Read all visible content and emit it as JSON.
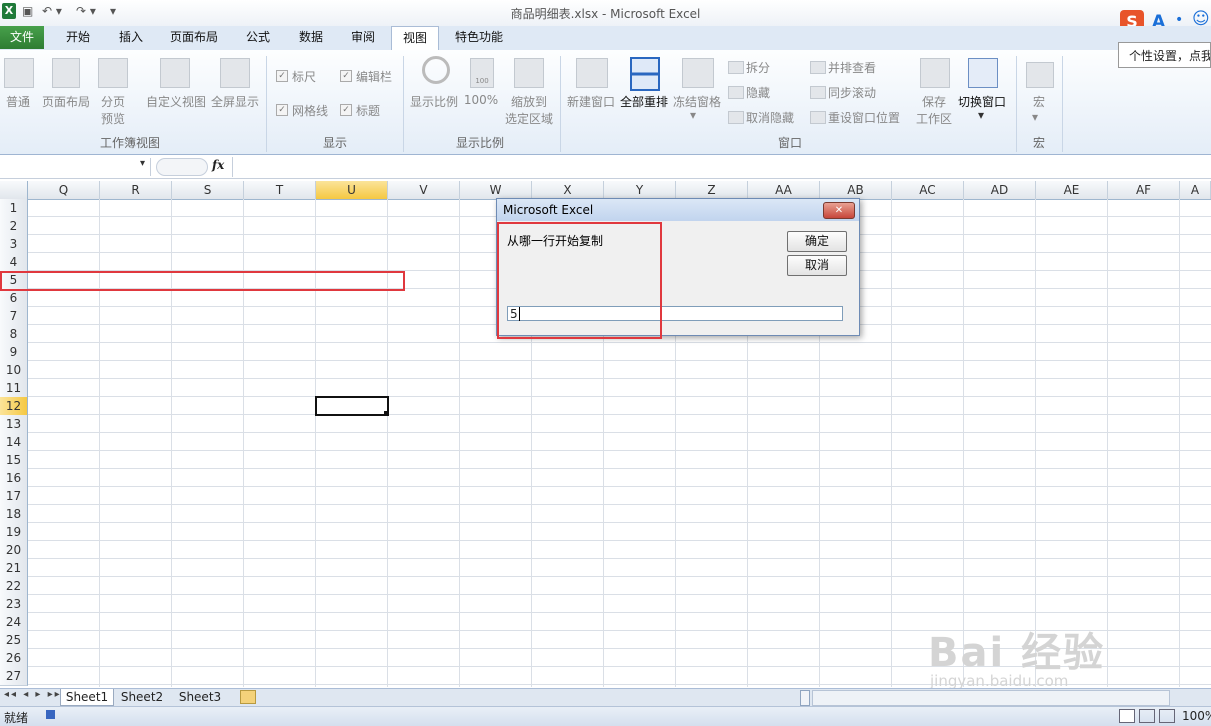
{
  "window": {
    "title": "商品明细表.xlsx  -  Microsoft Excel",
    "app_icon": "X"
  },
  "tabs": [
    "文件",
    "开始",
    "插入",
    "页面布局",
    "公式",
    "数据",
    "审阅",
    "视图",
    "特色功能"
  ],
  "ribbon": {
    "workbook_views": {
      "label": "工作簿视图",
      "normal": "普通",
      "page_layout": "页面布局",
      "page_break_1": "分页",
      "page_break_2": "预览",
      "custom": "自定义视图",
      "full_screen": "全屏显示"
    },
    "show": {
      "label": "显示",
      "ruler": "标尺",
      "formula_bar": "编辑栏",
      "gridlines": "网格线",
      "headings": "标题"
    },
    "zoom": {
      "label": "显示比例",
      "zoom": "显示比例",
      "z100": "100%",
      "zoom_sel_1": "缩放到",
      "zoom_sel_2": "选定区域",
      "icon_text": "100"
    },
    "window": {
      "label": "窗口",
      "new_window": "新建窗口",
      "arrange_all": "全部重排",
      "freeze": "冻结窗格",
      "split": "拆分",
      "hide": "隐藏",
      "unhide": "取消隐藏",
      "side_by_side": "并排查看",
      "sync_scroll": "同步滚动",
      "reset_pos": "重设窗口位置",
      "save_ws_1": "保存",
      "save_ws_2": "工作区",
      "switch": "切换窗口"
    },
    "macros": {
      "label": "宏",
      "macros": "宏"
    }
  },
  "ime": {
    "brand": "S",
    "a": "A",
    "dot": "•",
    "smile": "☺",
    "tooltip": "个性设置，点我"
  },
  "formula_bar": {
    "fx": "fx",
    "content": ""
  },
  "columns": [
    "Q",
    "R",
    "S",
    "T",
    "U",
    "V",
    "W",
    "X",
    "Y",
    "Z",
    "AA",
    "AB",
    "AC",
    "AD",
    "AE",
    "AF",
    "A"
  ],
  "rows": [
    "1",
    "2",
    "3",
    "4",
    "5",
    "6",
    "7",
    "8",
    "9",
    "10",
    "11",
    "12",
    "13",
    "14",
    "15",
    "16",
    "17",
    "18",
    "19",
    "20",
    "21",
    "22",
    "23",
    "24",
    "25",
    "26",
    "27"
  ],
  "sheets": [
    "Sheet1",
    "Sheet2",
    "Sheet3"
  ],
  "status": {
    "ready": "就绪",
    "zoom": "100%"
  },
  "dialog": {
    "title": "Microsoft Excel",
    "prompt": "从哪一行开始复制",
    "ok": "确定",
    "cancel": "取消",
    "input_value": "5",
    "close": "✕"
  },
  "watermark": {
    "main": "Bai  经验",
    "sub": "jingyan.baidu.com"
  },
  "colors": {
    "highlight_red": "#e0383e",
    "active_header": "#f5c842",
    "file_tab": "#2e7d32"
  }
}
